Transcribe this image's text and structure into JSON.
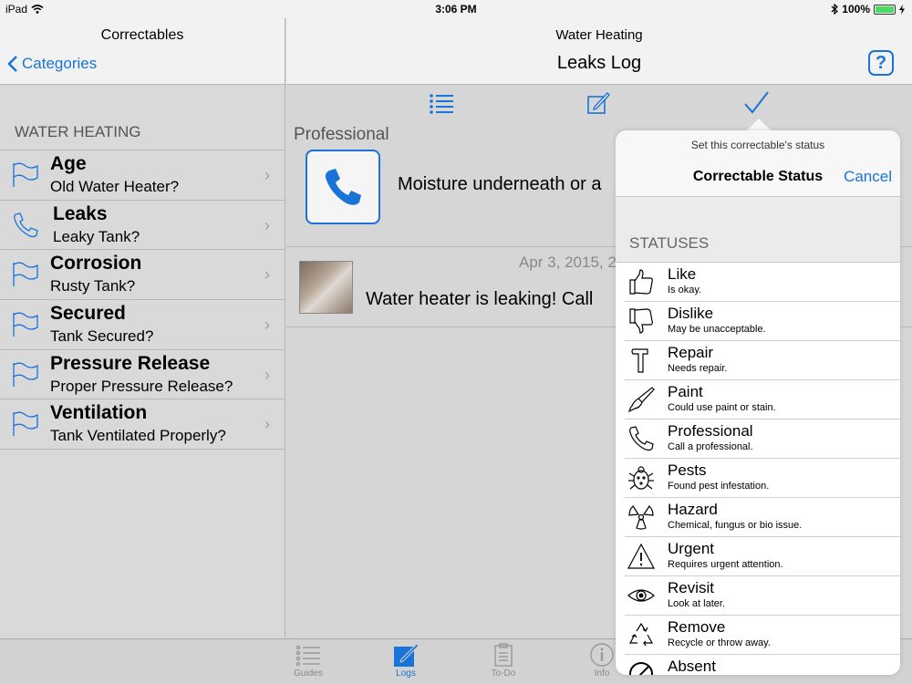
{
  "status_bar": {
    "device": "iPad",
    "time": "3:06 PM",
    "battery": "100%"
  },
  "left_pane": {
    "nav_title": "Correctables",
    "back_label": "Categories",
    "section_header": "WATER HEATING",
    "items": [
      {
        "title": "Age",
        "subtitle": "Old Water Heater?",
        "icon": "flag-icon"
      },
      {
        "title": "Leaks",
        "subtitle": "Leaky Tank?",
        "icon": "phone-icon"
      },
      {
        "title": "Corrosion",
        "subtitle": "Rusty Tank?",
        "icon": "flag-icon"
      },
      {
        "title": "Secured",
        "subtitle": "Tank Secured?",
        "icon": "flag-icon"
      },
      {
        "title": "Pressure Release",
        "subtitle": "Proper Pressure Release?",
        "icon": "flag-icon"
      },
      {
        "title": "Ventilation",
        "subtitle": "Tank Ventilated Properly?",
        "icon": "flag-icon"
      }
    ]
  },
  "main": {
    "nav_category": "Water Heating",
    "nav_title": "Leaks Log",
    "help_label": "?",
    "status_label": "Professional",
    "status_text": "Moisture underneath or a",
    "log_date": "Apr 3, 2015, 2",
    "log_text": "Water heater is leaking! Call"
  },
  "popover": {
    "prompt": "Set this correctable's status",
    "title": "Correctable Status",
    "cancel_label": "Cancel",
    "section_header": "STATUSES",
    "statuses": [
      {
        "name": "Like",
        "desc": "Is okay.",
        "icon": "thumbs-up-icon"
      },
      {
        "name": "Dislike",
        "desc": "May be unacceptable.",
        "icon": "thumbs-down-icon"
      },
      {
        "name": "Repair",
        "desc": "Needs repair.",
        "icon": "hammer-icon"
      },
      {
        "name": "Paint",
        "desc": "Could use paint or stain.",
        "icon": "paintbrush-icon"
      },
      {
        "name": "Professional",
        "desc": "Call a professional.",
        "icon": "phone-icon"
      },
      {
        "name": "Pests",
        "desc": "Found pest infestation.",
        "icon": "bug-icon"
      },
      {
        "name": "Hazard",
        "desc": "Chemical, fungus or bio issue.",
        "icon": "radiation-icon"
      },
      {
        "name": "Urgent",
        "desc": "Requires urgent attention.",
        "icon": "warning-icon"
      },
      {
        "name": "Revisit",
        "desc": "Look at later.",
        "icon": "eye-icon"
      },
      {
        "name": "Remove",
        "desc": "Recycle or throw away.",
        "icon": "recycle-icon"
      },
      {
        "name": "Absent",
        "desc": "",
        "icon": "absent-icon"
      }
    ]
  },
  "tab_bar": {
    "tabs": [
      {
        "label": "Guides",
        "icon": "list-icon",
        "active": false
      },
      {
        "label": "Logs",
        "icon": "logs-icon",
        "active": true
      },
      {
        "label": "To-Do",
        "icon": "clipboard-icon",
        "active": false
      },
      {
        "label": "Info",
        "icon": "info-icon",
        "active": false
      }
    ]
  },
  "colors": {
    "accent": "#1a73d9",
    "background": "#d6d6d6",
    "bar": "#f2f2f2"
  }
}
